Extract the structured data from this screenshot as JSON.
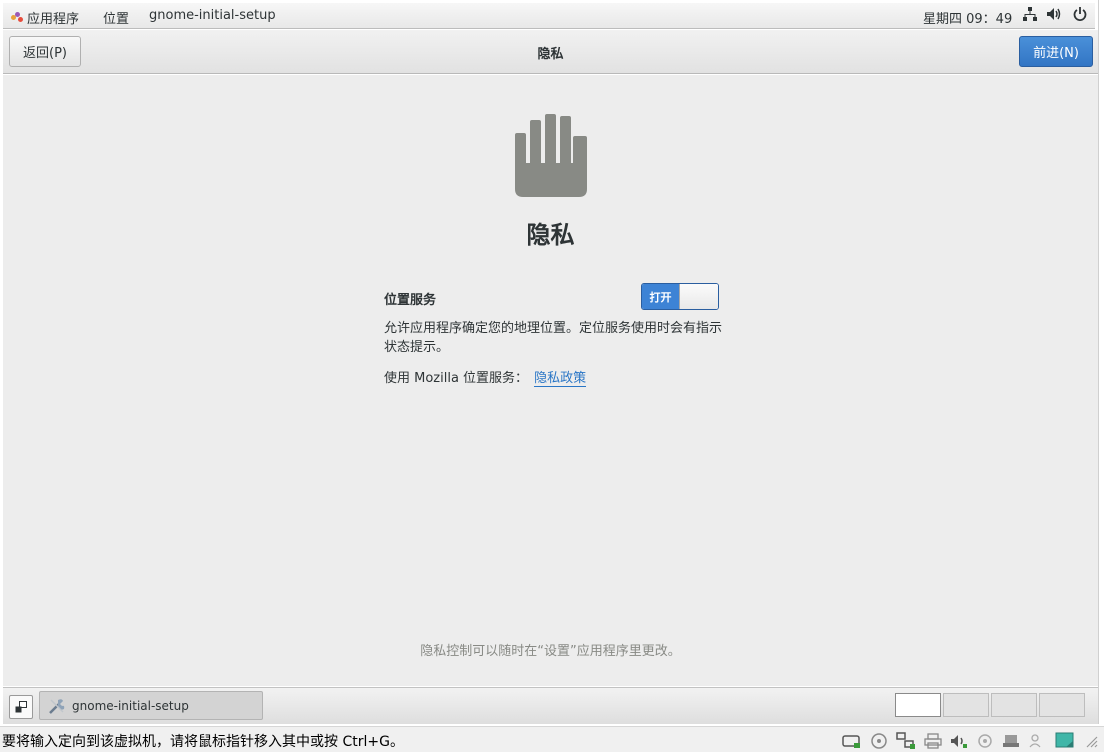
{
  "topbar": {
    "applications": "应用程序",
    "places": "位置",
    "app_name": "gnome-initial-setup",
    "clock": "星期四 09：49"
  },
  "headerbar": {
    "back_label": "返回(P)",
    "title": "隐私",
    "next_label": "前进(N)"
  },
  "page": {
    "title": "隐私",
    "location_label": "位置服务",
    "switch_state_label": "打开",
    "location_description": "允许应用程序确定您的地理位置。定位服务使用时会有指示状态提示。",
    "mozilla_prefix": "使用 Mozilla 位置服务：",
    "privacy_policy_link": "隐私政策",
    "footer_note": "隐私控制可以随时在“设置”应用程序里更改。"
  },
  "taskbar": {
    "task_label": "gnome-initial-setup",
    "workspaces": 4,
    "active_workspace": 1
  },
  "host_status": {
    "message": "要将输入定向到该虚拟机，请将鼠标指针移入其中或按 Ctrl+G。"
  },
  "colors": {
    "accent": "#3d83d5",
    "link": "#2a76c6",
    "content_bg": "#ededed",
    "icon_gray": "#888a85"
  }
}
